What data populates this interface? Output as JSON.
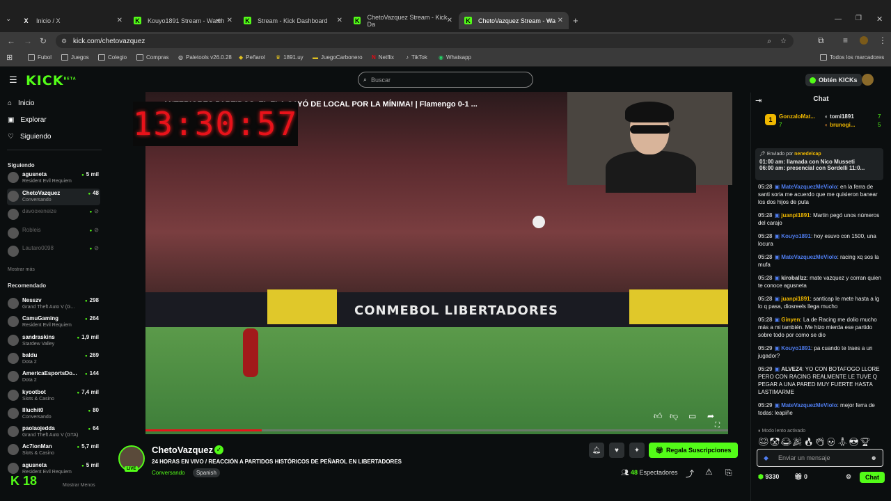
{
  "browser": {
    "tabs": [
      {
        "label": "Inicio / X",
        "icon": "X"
      },
      {
        "label": "Kouyo1891 Stream - Watch",
        "icon": "K"
      },
      {
        "label": "Stream - Kick Dashboard",
        "icon": "K"
      },
      {
        "label": "ChetoVazquez Stream - Kick Da",
        "icon": "K"
      },
      {
        "label": "ChetoVazquez Stream - Wa",
        "icon": "K"
      }
    ],
    "url": "kick.com/chetovazquez",
    "bookmarks": [
      "Fubol",
      "Juegos",
      "Colegio",
      "Compras",
      "Paletools v26.0.28",
      "Peñarol",
      "1891.uy",
      "JuegoCarbonero",
      "Netflix",
      "TikTok",
      "Whatsapp"
    ],
    "all_bookmarks": "Todos los marcadores"
  },
  "header": {
    "logo": "KICK",
    "logo_beta": "BETA",
    "search_placeholder": "Buscar",
    "kicks_button": "Obtén KICKs"
  },
  "sidebar": {
    "nav": [
      "Inicio",
      "Explorar",
      "Siguiendo"
    ],
    "following_title": "Siguiendo",
    "following": [
      {
        "name": "agusneta",
        "game": "Resident Evil Requiem",
        "viewers": "5 mil",
        "online": true
      },
      {
        "name": "ChetoVazquez",
        "game": "Conversando",
        "viewers": "48",
        "online": true
      },
      {
        "name": "davooxeneize",
        "game": "",
        "viewers": "",
        "online": false
      },
      {
        "name": "Robleis",
        "game": "",
        "viewers": "",
        "online": false
      },
      {
        "name": "Lautaro0098",
        "game": "",
        "viewers": "",
        "online": false
      }
    ],
    "show_more": "Mostrar más",
    "recommended_title": "Recomendado",
    "recommended": [
      {
        "name": "Nesszv",
        "game": "Grand Theft Auto V (G...",
        "viewers": "298"
      },
      {
        "name": "CamuGaming",
        "game": "Resident Evil Requiem",
        "viewers": "264"
      },
      {
        "name": "sandraskins",
        "game": "Stardew Valley",
        "viewers": "1,9 mil"
      },
      {
        "name": "baldu",
        "game": "Dota 2",
        "viewers": "269"
      },
      {
        "name": "AmericaEsportsDo...",
        "game": "Dota 2",
        "viewers": "144"
      },
      {
        "name": "kyootbot",
        "game": "Slots & Casino",
        "viewers": "7,4 mil"
      },
      {
        "name": "Illuchit0",
        "game": "Conversando",
        "viewers": "80"
      },
      {
        "name": "paolaojedda",
        "game": "Grand Theft Auto V (GTA)",
        "viewers": "64"
      },
      {
        "name": "Ac7ionMan",
        "game": "Slots & Casino",
        "viewers": "5,7 mil"
      },
      {
        "name": "agusneta",
        "game": "Resident Evil Requiem",
        "viewers": "5 mil"
      }
    ],
    "show_less": "Mostrar Menos",
    "k18": "18"
  },
  "video": {
    "title": "...ANTERIORES PARTIDOS, EL FLA CAYÓ DE LOCAL POR LA MÍNIMA! | Flamengo 0-1 ...",
    "clock": "13:30:57",
    "ad_text": "CONMEBOL LIBERTADORES",
    "progress": 0.2
  },
  "stream": {
    "channel": "ChetoVazquez",
    "title": "24 HORAS EN VIVO / REACCIÓN A PARTIDOS HISTÓRICOS DE PEÑAROL EN LIBERTADORES",
    "category": "Conversando",
    "language": "Spanish",
    "live": "LIVE",
    "subscribe": "Regala Suscripciones",
    "viewers_count": "48",
    "viewers_label": "Espectadores"
  },
  "chat": {
    "title": "Chat",
    "top": [
      {
        "name": "GonzaloMat...",
        "count": "7"
      },
      {
        "name": "tomi1891",
        "count": "7"
      },
      {
        "name": "brunogi...",
        "count": "5"
      }
    ],
    "pinned_by_label": "Enviado por",
    "pinned_by": "nenedelcap",
    "pinned_line1": "01:00 am: llamada con Nico Musseti",
    "pinned_line2": "06:00 am: presencial con Sordelli 11:0...",
    "messages": [
      {
        "time": "05:28",
        "user": "MateVazquezMeViolo",
        "color": "#4f7df0",
        "text": "en la ferra de santi soria me acuerdo que me quisieron banear los dos hijos de puta"
      },
      {
        "time": "05:28",
        "user": "juanpi1891",
        "color": "#f0b800",
        "text": "Martin pegó unos números del carajo"
      },
      {
        "time": "05:28",
        "user": "Kouyo1891",
        "color": "#4f7df0",
        "text": "hoy esuvo con 1500, una locura"
      },
      {
        "time": "05:28",
        "user": "MateVazquezMeViolo",
        "color": "#4f7df0",
        "text": "racing xq sos la mufa"
      },
      {
        "time": "05:28",
        "user": "kiroballzz",
        "color": "#dddddd",
        "text": "mate vazquez y corran quien te conoce agusneta"
      },
      {
        "time": "05:28",
        "user": "juanpi1891",
        "color": "#f0b800",
        "text": "santicap le mete hasta a lg lo q pasa, diosreels llega mucho"
      },
      {
        "time": "05:28",
        "user": "Ginyen",
        "color": "#f0b800",
        "text": "La de Racing me dolio mucho más a mi también. Me hizo mierda ese partido sobre todo por como se dio"
      },
      {
        "time": "05:29",
        "user": "Kouyo1891",
        "color": "#4f7df0",
        "text": "pa cuando te traes a un jugador?"
      },
      {
        "time": "05:29",
        "user": "ALVEZ4",
        "color": "#dddddd",
        "text": "YO CON BOTAFOGO LLORE PERO CON RACING REALMENTE LE TUVE Q PEGAR A UNA PARED MUY FUERTE HASTA LASTIMARME"
      },
      {
        "time": "05:29",
        "user": "MateVazquezMeViolo",
        "color": "#4f7df0",
        "text": "mejor ferra de todas: leapiñe"
      }
    ],
    "slow_mode": "Modo lento activado",
    "input_placeholder": "Enviar un mensaje",
    "points": "9330",
    "gifts": "0",
    "chat_button": "Chat"
  }
}
